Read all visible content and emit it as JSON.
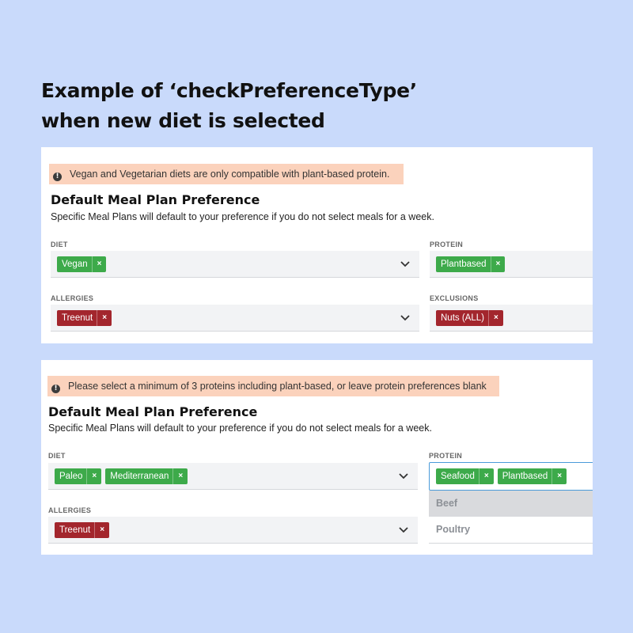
{
  "heading": {
    "line1": "Example of ‘checkPreferenceType’",
    "line2": "when new diet is selected"
  },
  "panel1": {
    "alert": "Vegan and Vegetarian diets are only compatible with plant-based protein.",
    "title": "Default Meal Plan Preference",
    "subtitle": "Specific Meal Plans will default to your preference if you do not select meals for a week.",
    "diet": {
      "label": "DIET",
      "tags": [
        "Vegan"
      ]
    },
    "protein": {
      "label": "PROTEIN",
      "tags": [
        "Plantbased"
      ]
    },
    "allergies": {
      "label": "ALLERGIES",
      "tags": [
        "Treenut"
      ]
    },
    "exclusions": {
      "label": "EXCLUSIONS",
      "tags": [
        "Nuts (ALL)"
      ]
    }
  },
  "panel2": {
    "alert": "Please select a minimum of 3 proteins including plant-based, or leave protein preferences blank",
    "title": "Default Meal Plan Preference",
    "subtitle": "Specific Meal Plans will default to your preference if you do not select meals for a week.",
    "diet": {
      "label": "DIET",
      "tags": [
        "Paleo",
        "Mediterranean"
      ]
    },
    "protein": {
      "label": "PROTEIN",
      "tags": [
        "Seafood",
        "Plantbased"
      ]
    },
    "allergies": {
      "label": "ALLERGIES",
      "tags": [
        "Treenut"
      ]
    },
    "protein_options": [
      "Beef",
      "Poultry"
    ]
  },
  "tag_remove_glyph": "×",
  "colors": {
    "background": "#c9dafb",
    "alert": "#fbd2bc",
    "tag_green": "#3daa4a",
    "tag_red": "#a3262d",
    "focus_border": "#4a9bd9"
  }
}
